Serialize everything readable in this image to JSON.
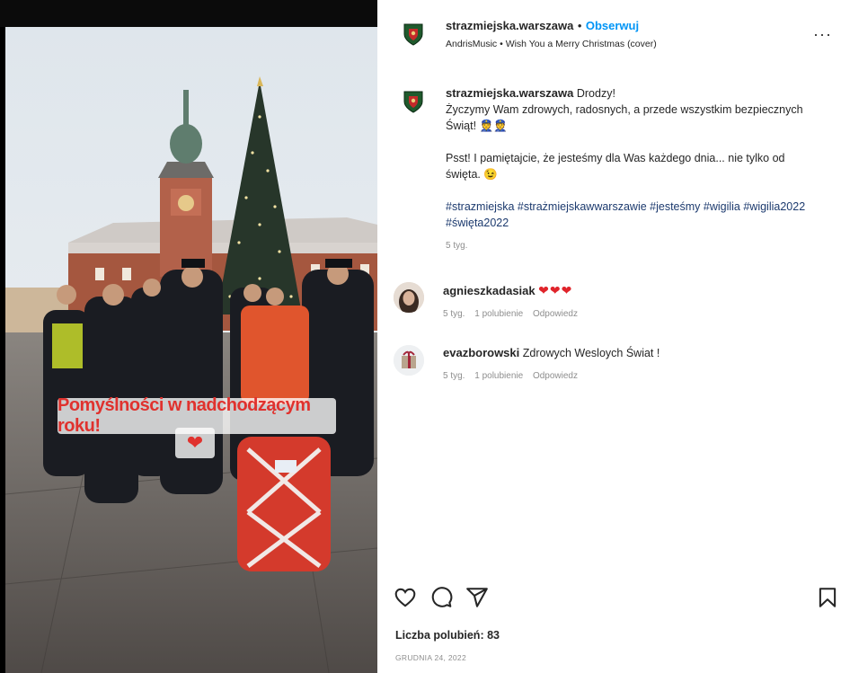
{
  "post": {
    "story_caption": "Pomyślności w nadchodzącym roku!",
    "story_heart": "❤"
  },
  "header": {
    "username": "strazmiejska.warszawa",
    "separator": "•",
    "follow_label": "Obserwuj",
    "audio": "AndrisMusic • Wish You a Merry Christmas (cover)",
    "more_label": "···"
  },
  "caption": {
    "username": "strazmiejska.warszawa",
    "line1": "Drodzy!",
    "line2": "Życzymy Wam zdrowych, radosnych, a przede wszystkim bezpiecznych Świąt! 👮👮",
    "line3": "Psst! I pamiętajcie, że jesteśmy dla Was każdego dnia... nie tylko od święta. 😉",
    "hashtags": "#strazmiejska #strażmiejskawwarszawie #jesteśmy #wigilia #wigilia2022 #święta2022",
    "time": "5 tyg."
  },
  "comments": [
    {
      "username": "agnieszkadasiak",
      "text": "❤❤❤",
      "time": "5 tyg.",
      "likes": "1 polubienie",
      "reply": "Odpowiedz"
    },
    {
      "username": "evazborowski",
      "text": "Zdrowych Wesloych Świat !",
      "time": "5 tyg.",
      "likes": "1 polubienie",
      "reply": "Odpowiedz"
    }
  ],
  "actions": {
    "like_icon": "heart-outline-icon",
    "comment_icon": "speech-bubble-icon",
    "share_icon": "paper-plane-icon",
    "save_icon": "bookmark-icon"
  },
  "likes_text": "Liczba polubień: 83",
  "date": "GRUDNIA 24, 2022",
  "colors": {
    "follow": "#0095f6",
    "hashtag": "#1c3a6e",
    "muted": "#8e8e8e",
    "heart": "#e0242b"
  }
}
